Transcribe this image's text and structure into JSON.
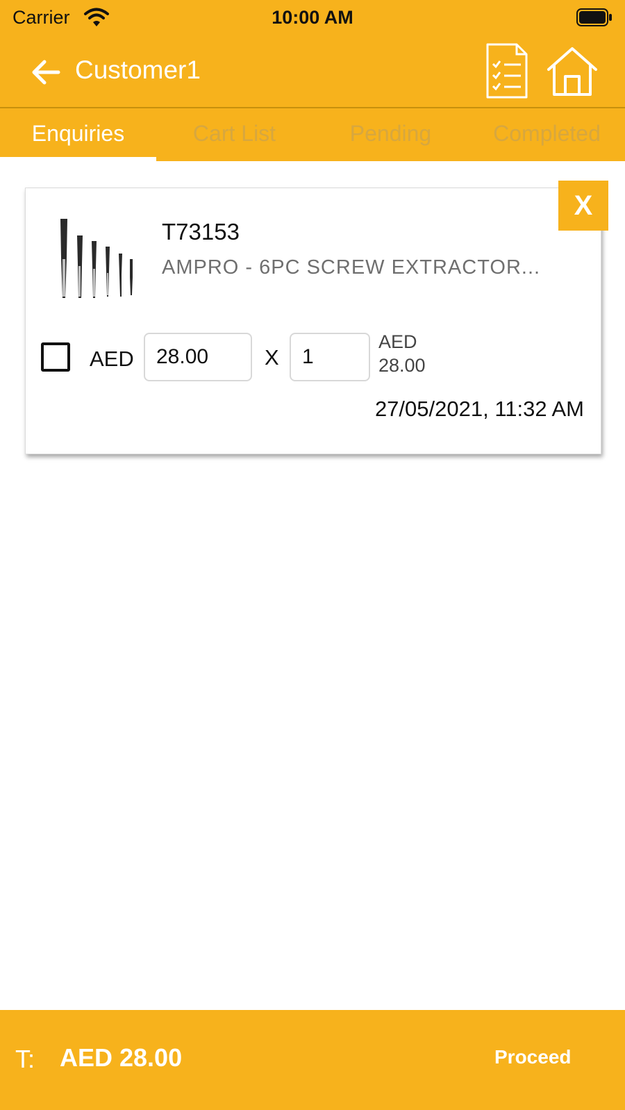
{
  "status_bar": {
    "carrier": "Carrier",
    "time": "10:00 AM"
  },
  "header": {
    "title": "Customer1",
    "icons": [
      "back-arrow-icon",
      "order-list-icon",
      "home-icon"
    ]
  },
  "tabs": [
    {
      "label": "Enquiries",
      "active": true
    },
    {
      "label": "Cart List",
      "active": false
    },
    {
      "label": "Pending",
      "active": false
    },
    {
      "label": "Completed",
      "active": false
    }
  ],
  "enquiry": {
    "close_label": "X",
    "code": "T73153",
    "name": "AMPRO - 6PC SCREW EXTRACTOR...",
    "currency": "AED",
    "unit_price": "28.00",
    "multiply": "X",
    "quantity": "1",
    "line_currency": "AED",
    "line_total": "28.00",
    "timestamp": "27/05/2021, 11:32 AM",
    "selected": false
  },
  "footer": {
    "total_label": "T:",
    "total_value": "AED 28.00",
    "proceed_label": "Proceed"
  },
  "colors": {
    "accent": "#f7b21c",
    "inactive_tab": "#d7a73f",
    "text": "#111111"
  }
}
